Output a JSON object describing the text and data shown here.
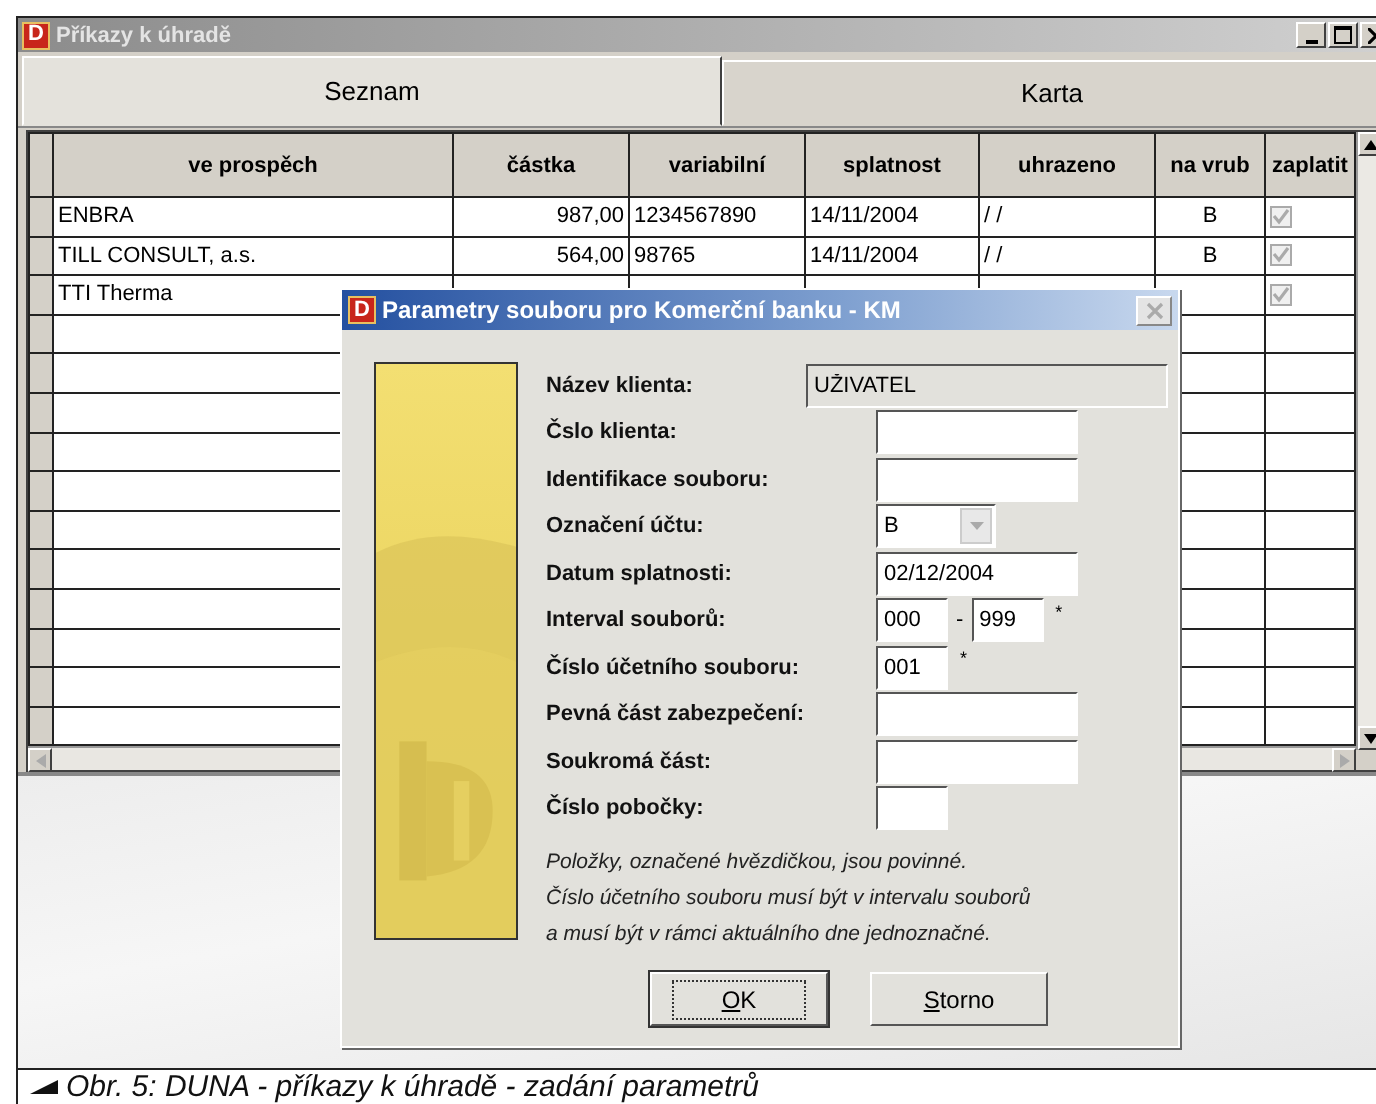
{
  "window": {
    "icon_letter": "D",
    "title": "Příkazy k úhradě",
    "active": false
  },
  "tabs": [
    {
      "label": "Seznam",
      "selected": true
    },
    {
      "label": "Karta",
      "selected": false
    }
  ],
  "table": {
    "columns": [
      "ve prospěch",
      "částka",
      "variabilní",
      "splatnost",
      "uhrazeno",
      "na vrub",
      "zaplatit"
    ],
    "rows": [
      {
        "cells": [
          "ENBRA",
          "987,00",
          "1234567890",
          "14/11/2004",
          "/ /",
          "B"
        ],
        "checked": true
      },
      {
        "cells": [
          "TILL CONSULT, a.s.",
          "564,00",
          "98765",
          "14/11/2004",
          "/ /",
          "B"
        ],
        "checked": true
      },
      {
        "cells": [
          "TTI Therma"
        ],
        "checked": true
      }
    ]
  },
  "dialog": {
    "icon_letter": "D",
    "title": "Parametry souboru pro Komerční banku - KM",
    "active": true,
    "fields": [
      {
        "label": "Název klienta:",
        "kind": "readonly",
        "value": "UŽIVATEL"
      },
      {
        "label": "Čslo klienta:",
        "kind": "text"
      },
      {
        "label": "Identifikace souboru:",
        "kind": "text"
      },
      {
        "label": "Označení účtu:",
        "kind": "dropdown",
        "value": "B"
      },
      {
        "label": "Datum splatnosti:",
        "kind": "text",
        "value": "02/12/2004"
      },
      {
        "label": "Interval souborů:",
        "kind": "range",
        "value": "000",
        "separator": "-",
        "value_to": "999",
        "mark": "*"
      },
      {
        "label": "Číslo účetního souboru:",
        "kind": "short",
        "value": "001",
        "mark": "*"
      },
      {
        "label": "Pevná část zabezpečení:",
        "kind": "text"
      },
      {
        "label": "Soukromá část:",
        "kind": "text"
      },
      {
        "label": "Číslo pobočky:",
        "kind": "short"
      }
    ],
    "note": "Položky, označené hvězdičkou, jsou povinné.\nČíslo účetního souboru musí být v intervalu souborů\na musí být v rámci aktuálního dne jednoznačné.",
    "buttons": [
      {
        "label": "OK",
        "default": true
      },
      {
        "label": "Storno",
        "default": false
      }
    ]
  },
  "caption": "Obr. 5: DUNA - příkazy k úhradě - zadání parametrů"
}
